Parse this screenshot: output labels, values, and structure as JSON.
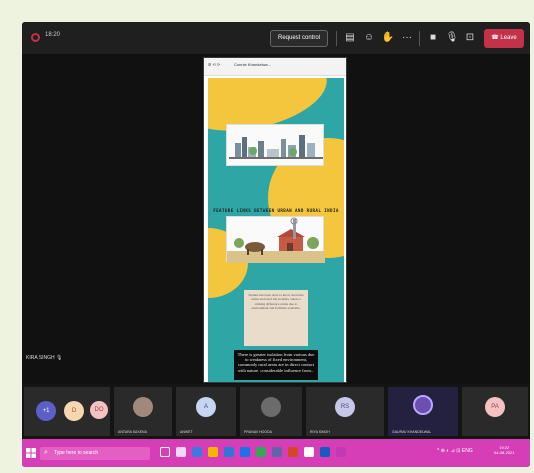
{
  "meeting": {
    "timer": "18:20",
    "request_control_label": "Request control",
    "more_label": "···",
    "leave_label": "Leave",
    "accent": "#c4314b"
  },
  "shared": {
    "tab_title": "Connie Khandelwa...",
    "slide": {
      "heading": "FEATURE LINKS BETWEEN URBAN AND RURAL INDIA",
      "text_card": "Studies has been done to know about the urban and rural life in India, where a striking difference exists due to environment and facilities available.",
      "black_card": "There is greater isolation from various due to weakness of fixed environment, commonly rural areas are in direct contact with nature. considerable influence from..."
    }
  },
  "speaker_label": "KIRA SINGH",
  "participants": [
    {
      "initials": "+1",
      "name": "",
      "color": "#5b5fc7"
    },
    {
      "initials": "D",
      "name": "",
      "color": "#f6d7b0"
    },
    {
      "initials": "DO",
      "name": "",
      "color": "#f4c2c2"
    },
    {
      "initials": "",
      "name": "ANTARA SAXENA",
      "color": "#a0897a"
    },
    {
      "initials": "A",
      "name": "ANIKET",
      "color": "#c7d6f0"
    },
    {
      "initials": "",
      "name": "PRANAV HOODA",
      "color": "#6b6b6b"
    },
    {
      "initials": "RS",
      "name": "RIYA SINGH",
      "color": "#c7c7e8"
    },
    {
      "initials": "",
      "name": "GAURAV KHANDELWAL",
      "color": "#6a4fb0"
    },
    {
      "initials": "PA",
      "name": "",
      "color": "#f4c2c2"
    }
  ],
  "taskbar": {
    "search_placeholder": "Type here to search",
    "tray_label": "^ ⊕ ◐ ⊿ ⊡ ENG",
    "clock_time": "19:22",
    "clock_date": "04-08-2021"
  },
  "icons": [
    "record-icon",
    "camera-icon",
    "mic-icon",
    "share-icon",
    "reaction-icon",
    "hand-icon",
    "start-icon",
    "search-icon"
  ]
}
